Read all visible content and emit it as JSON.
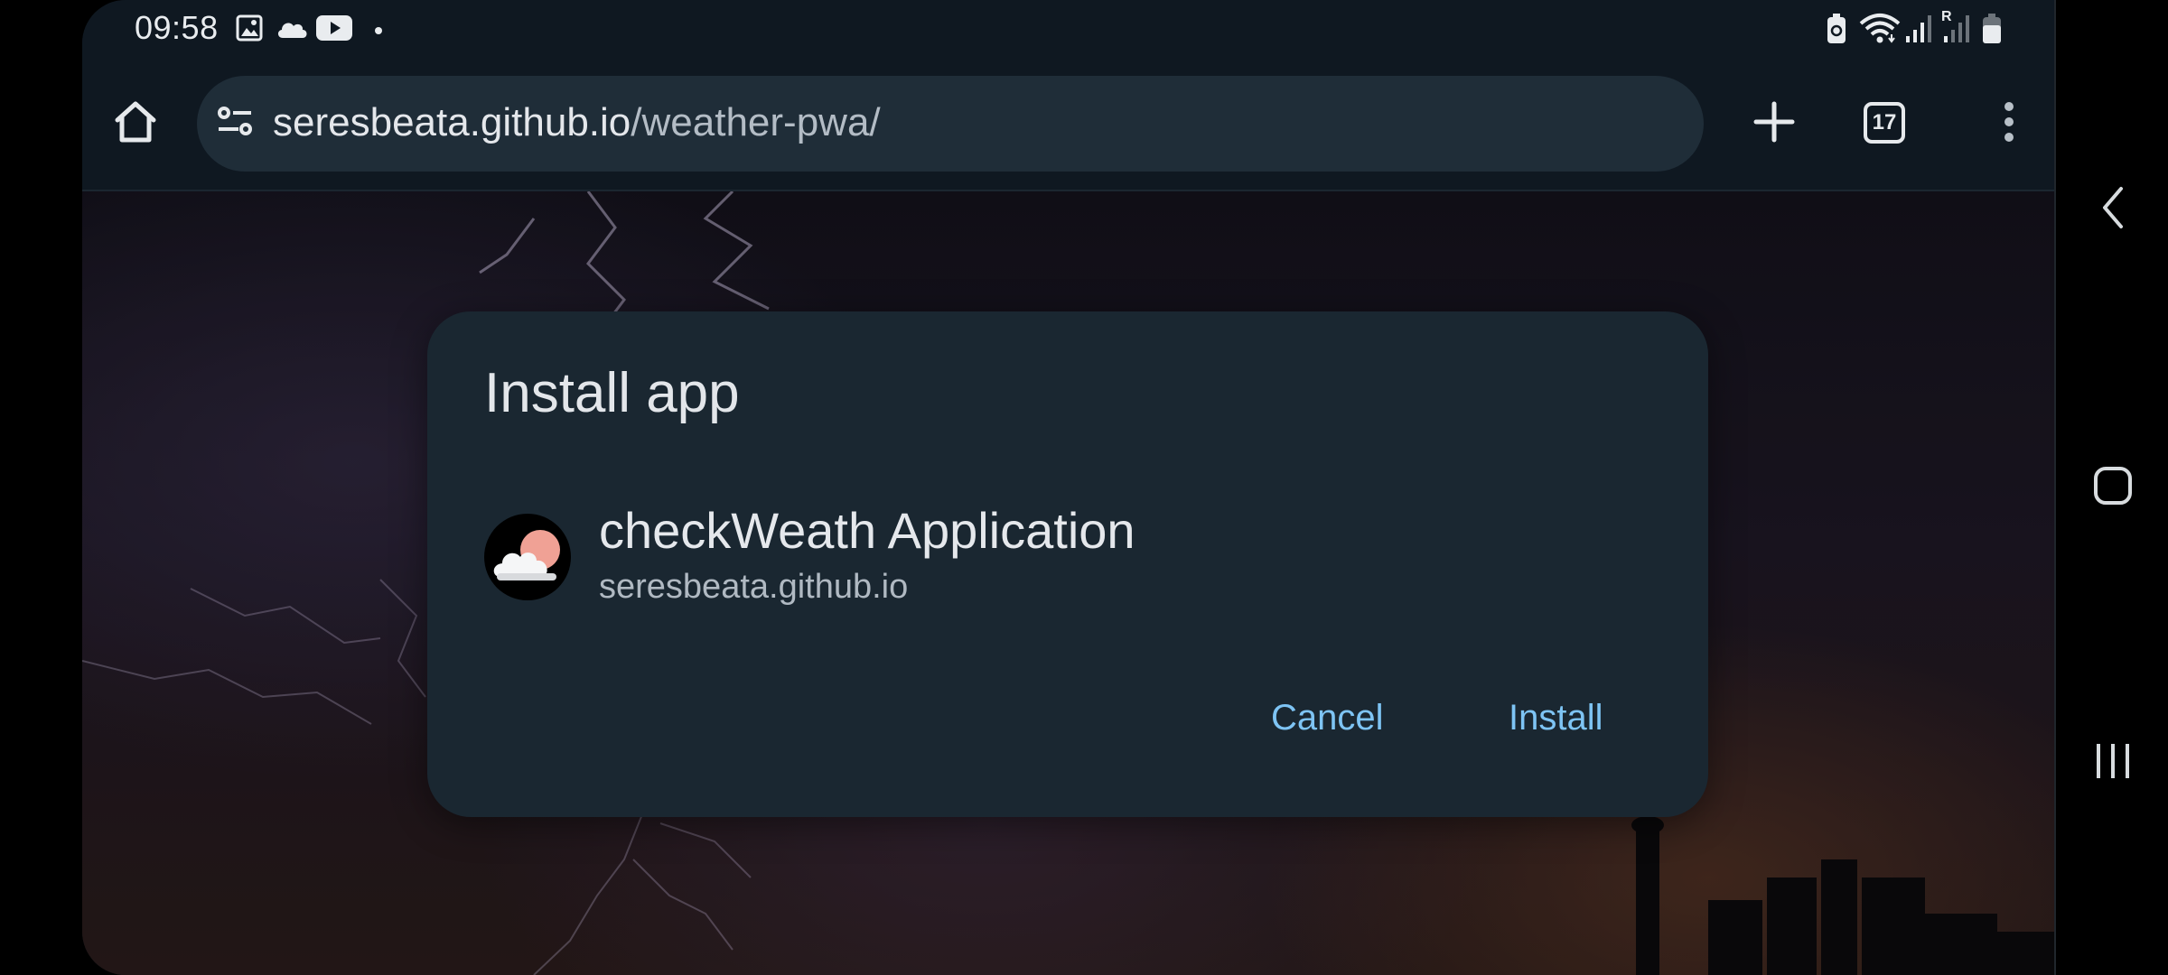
{
  "status_bar": {
    "time": "09:58",
    "left_icons": [
      "gallery-icon",
      "cloud-icon",
      "youtube-icon",
      "dot-icon"
    ],
    "right_icons": [
      "battery-saver-icon",
      "wifi-icon",
      "signal-icon",
      "signal-roaming-icon",
      "battery-icon"
    ],
    "roaming_label": "R"
  },
  "toolbar": {
    "home_icon": "home-icon",
    "omnibox": {
      "security_icon": "tune-icon",
      "host": "seresbeata.github.io",
      "path": "/weather-pwa/"
    },
    "new_tab_icon": "plus-icon",
    "tab_count": "17",
    "menu_icon": "more-vert-icon"
  },
  "dialog": {
    "title": "Install app",
    "app_name": "checkWeath Application",
    "app_origin": "seresbeata.github.io",
    "cancel_label": "Cancel",
    "install_label": "Install",
    "accent_color": "#7ec4f4"
  },
  "nav_bar": {
    "back_icon": "back-chevron-icon",
    "home_icon": "home-square-icon",
    "recents_icon": "recents-icon"
  }
}
